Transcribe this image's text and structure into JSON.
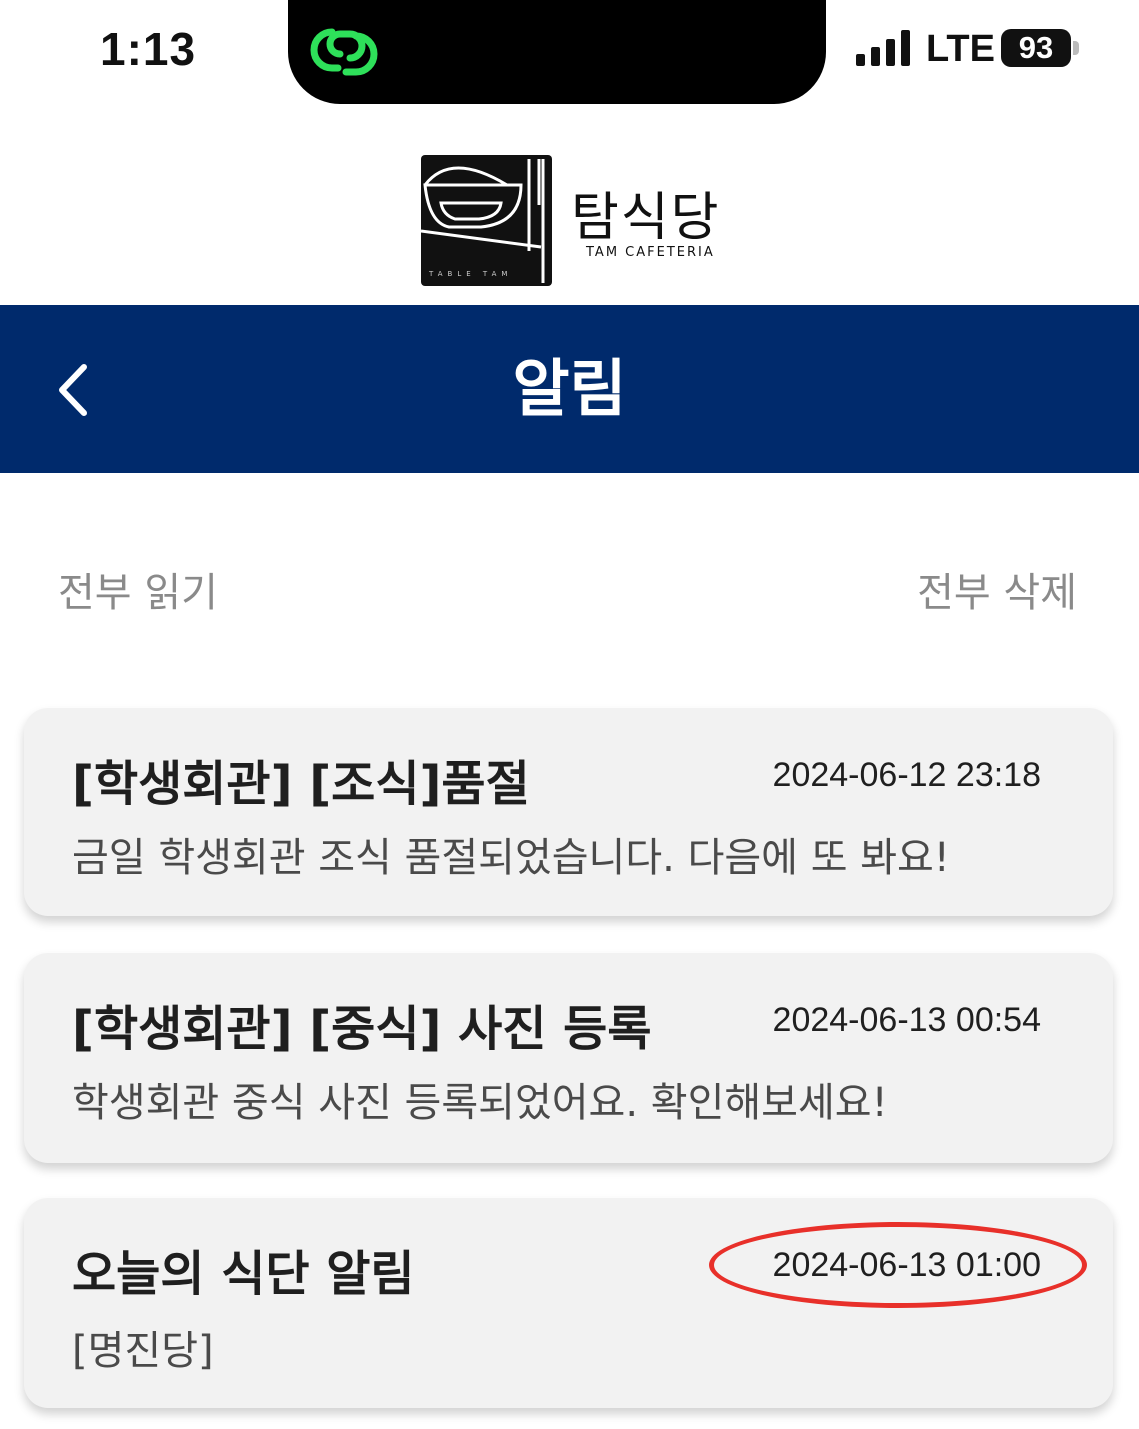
{
  "status_bar": {
    "time": "1:13",
    "network": "LTE",
    "battery": "93"
  },
  "logo": {
    "name": "탐식당",
    "subtitle": "TAM CAFETERIA",
    "mark_text": "TABLE TAM"
  },
  "header": {
    "title": "알림",
    "background": "#002a6c"
  },
  "actions": {
    "read_all": "전부 읽기",
    "delete_all": "전부 삭제"
  },
  "notifications": [
    {
      "title": "[학생회관] [조식]품절",
      "date": "2024-06-12 23:18",
      "body": "금일 학생회관 조식 품절되었습니다. 다음에 또 봐요!"
    },
    {
      "title": "[학생회관] [중식] 사진 등록",
      "date": "2024-06-13 00:54",
      "body": "학생회관 중식 사진 등록되었어요. 확인해보세요!"
    },
    {
      "title": "오늘의 식단 알림",
      "date": "2024-06-13 01:00",
      "body": "[명진당]"
    }
  ],
  "annotation": {
    "color": "#e8302a",
    "target": "notifications.2.date"
  }
}
